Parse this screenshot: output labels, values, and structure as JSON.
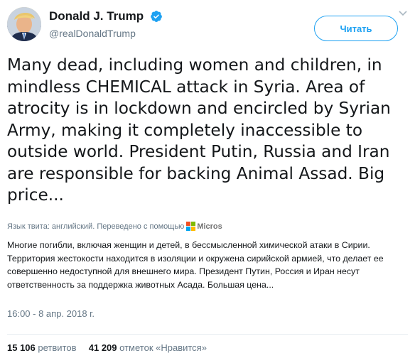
{
  "user": {
    "display_name": "Donald J. Trump",
    "handle": "@realDonaldTrump",
    "verified": true,
    "avatar_icon": "profile-photo"
  },
  "follow_button": {
    "label": "Читать"
  },
  "tweet": {
    "text": "Many dead, including women and children, in mindless CHEMICAL attack in Syria. Area of atrocity is in lockdown and encircled by Syrian Army, making it completely inaccessible to outside world. President Putin, Russia and Iran are responsible for backing Animal Assad. Big price..."
  },
  "translation": {
    "meta_label": "Язык твита: английский. Переведено с помощью",
    "provider": "Micros",
    "text": "Многие погибли, включая женщин и детей, в бессмысленной химической атаки в Сирии. Территория жестокости находится в изоляции и окружена сирийской армией, что делает ее совершенно недоступной для внешнего мира. Президент Путин, Россия и Иран несут ответственность за поддержка животных Асада. Большая цена..."
  },
  "timestamp": "16:00 - 8 апр. 2018 г.",
  "stats": {
    "retweets_count": "15 106",
    "retweets_label": "ретвитов",
    "likes_count": "41 209",
    "likes_label": "отметок «Нравится»"
  },
  "colors": {
    "accent": "#1da1f2",
    "text": "#14171a",
    "muted": "#657786"
  }
}
